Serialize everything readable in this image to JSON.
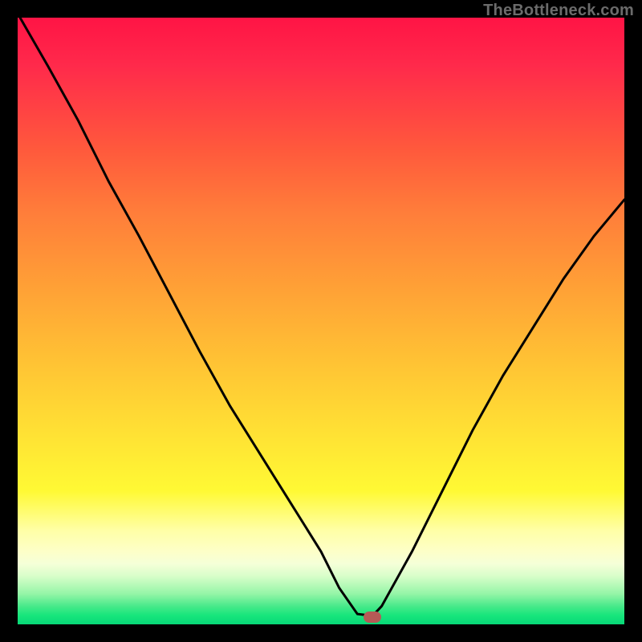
{
  "attribution": "TheBottleneck.com",
  "marker": {
    "x_pct": 58.5,
    "y_pct": 98.8
  },
  "chart_data": {
    "type": "line",
    "title": "",
    "xlabel": "",
    "ylabel": "",
    "xlim": [
      0,
      100
    ],
    "ylim": [
      0,
      100
    ],
    "grid": false,
    "series": [
      {
        "name": "bottleneck-curve",
        "x": [
          0.4,
          5,
          10,
          15,
          20,
          25,
          30,
          35,
          40,
          45,
          50,
          53,
          56,
          58.5,
          60,
          65,
          70,
          75,
          80,
          85,
          90,
          95,
          100
        ],
        "values": [
          100,
          92,
          83,
          73,
          64,
          54.5,
          45,
          36,
          28,
          20,
          12,
          6,
          1.7,
          1.4,
          3,
          12,
          22,
          32,
          41,
          49,
          57,
          64,
          70
        ]
      }
    ],
    "background_gradient": [
      {
        "pct": 0,
        "color": "#ff1445"
      },
      {
        "pct": 8,
        "color": "#ff2a4b"
      },
      {
        "pct": 22,
        "color": "#ff5a3c"
      },
      {
        "pct": 32,
        "color": "#ff7d3a"
      },
      {
        "pct": 45,
        "color": "#ffa236"
      },
      {
        "pct": 58,
        "color": "#ffc634"
      },
      {
        "pct": 70,
        "color": "#ffe534"
      },
      {
        "pct": 78,
        "color": "#fff934"
      },
      {
        "pct": 84.5,
        "color": "#ffffa6"
      },
      {
        "pct": 88,
        "color": "#fdffc8"
      },
      {
        "pct": 90,
        "color": "#f5ffd8"
      },
      {
        "pct": 92,
        "color": "#d9feca"
      },
      {
        "pct": 95,
        "color": "#94f5a7"
      },
      {
        "pct": 97,
        "color": "#48e98a"
      },
      {
        "pct": 98.5,
        "color": "#18e67c"
      },
      {
        "pct": 100,
        "color": "#07d877"
      }
    ],
    "marker": {
      "x": 58.5,
      "y": 1.2,
      "color": "#b65a56"
    }
  }
}
